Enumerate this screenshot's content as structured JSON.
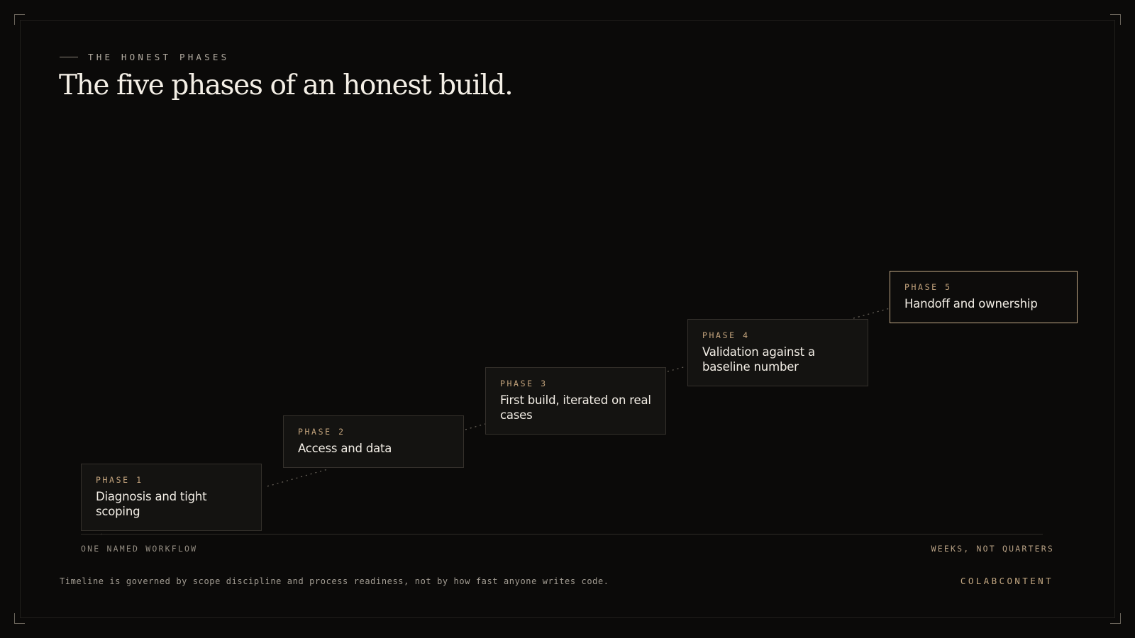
{
  "eyebrow": "THE HONEST PHASES",
  "title": "The five phases of an honest build.",
  "phases": [
    {
      "label": "PHASE 1",
      "title": "Diagnosis and tight scoping"
    },
    {
      "label": "PHASE 2",
      "title": "Access and data"
    },
    {
      "label": "PHASE 3",
      "title": "First build, iterated on real cases"
    },
    {
      "label": "PHASE 4",
      "title": "Validation against a baseline number"
    },
    {
      "label": "PHASE 5",
      "title": "Handoff and ownership"
    }
  ],
  "active_phase": "PHASE 5",
  "axis": {
    "start": "ONE NAMED WORKFLOW",
    "end": "WEEKS, NOT QUARTERS"
  },
  "footnote": "Timeline is governed by scope discipline and process readiness, not by how fast anyone writes code.",
  "brand": "COLABCONTENT",
  "colors": {
    "background": "#0b0a09",
    "accent": "#c4a47d",
    "card": "#141311",
    "active_border": "#c2aa86"
  }
}
